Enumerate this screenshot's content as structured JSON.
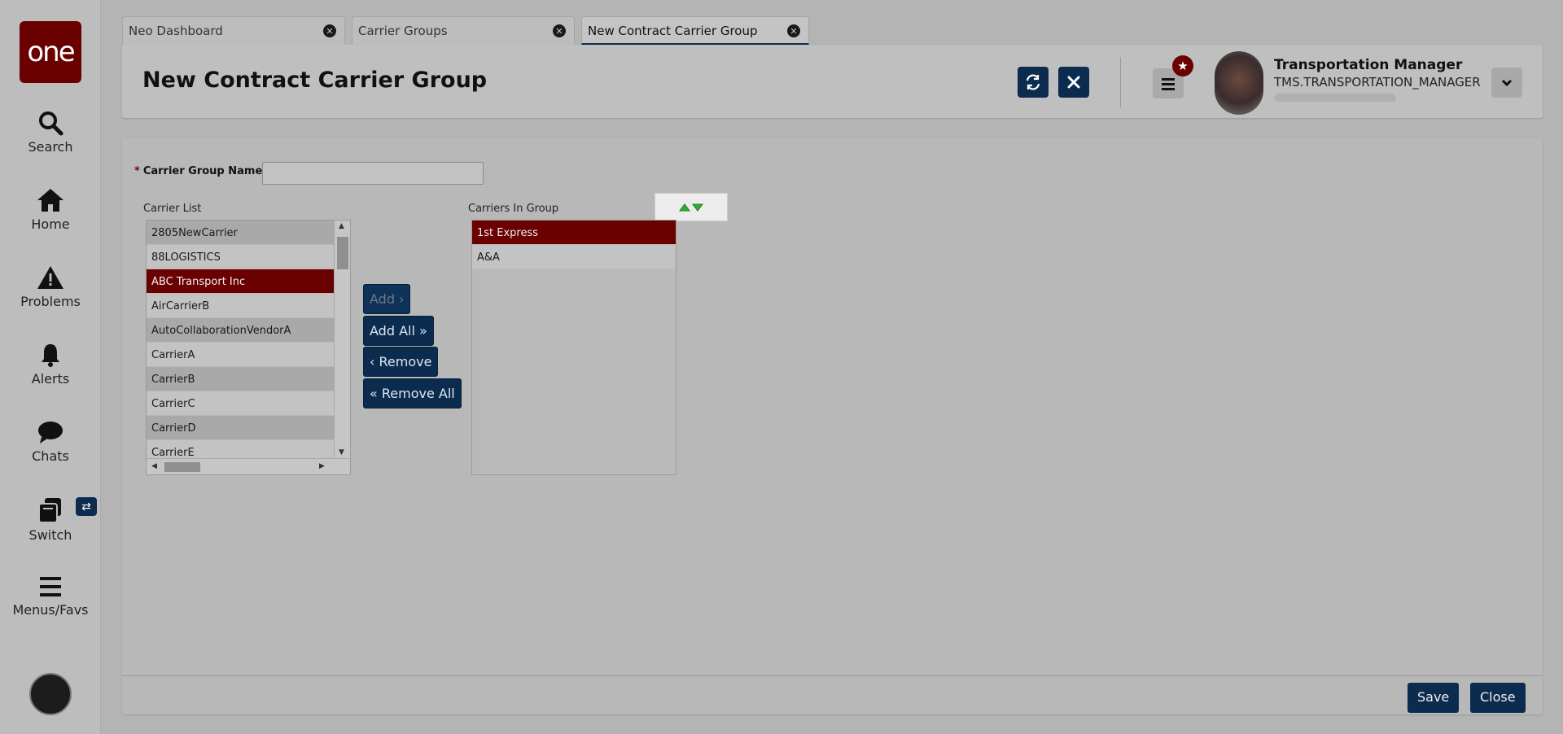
{
  "sidebar": {
    "logo": "one",
    "items": [
      {
        "label": "Search",
        "icon": "search-icon"
      },
      {
        "label": "Home",
        "icon": "home-icon"
      },
      {
        "label": "Problems",
        "icon": "warning-icon"
      },
      {
        "label": "Alerts",
        "icon": "bell-icon"
      },
      {
        "label": "Chats",
        "icon": "chat-icon"
      },
      {
        "label": "Switch",
        "icon": "switch-icon"
      },
      {
        "label": "Menus/Favs",
        "icon": "menu-icon"
      }
    ],
    "switch_badge": "⇄"
  },
  "tabs": [
    {
      "label": "Neo Dashboard",
      "active": false
    },
    {
      "label": "Carrier Groups",
      "active": false
    },
    {
      "label": "New Contract Carrier Group",
      "active": true
    }
  ],
  "header": {
    "title": "New Contract Carrier Group",
    "user_name": "Transportation Manager",
    "user_role": "TMS.TRANSPORTATION_MANAGER"
  },
  "form": {
    "name_label": "Carrier Group Name:",
    "required_mark": "*",
    "name_value": "",
    "carrier_list_label": "Carrier List",
    "carriers_in_group_label": "Carriers In Group",
    "carrier_list": [
      {
        "name": "2805NewCarrier",
        "selected": false
      },
      {
        "name": "88LOGISTICS",
        "selected": false
      },
      {
        "name": "ABC Transport Inc",
        "selected": true
      },
      {
        "name": "AirCarrierB",
        "selected": false
      },
      {
        "name": "AutoCollaborationVendorA",
        "selected": false
      },
      {
        "name": "CarrierA",
        "selected": false
      },
      {
        "name": "CarrierB",
        "selected": false
      },
      {
        "name": "CarrierC",
        "selected": false
      },
      {
        "name": "CarrierD",
        "selected": false
      },
      {
        "name": "CarrierE",
        "selected": false
      }
    ],
    "carriers_in_group": [
      {
        "name": "1st Express",
        "selected": true
      },
      {
        "name": "A&A",
        "selected": false
      }
    ],
    "buttons": {
      "add": "Add ›",
      "add_all": "Add All »",
      "remove": "‹ Remove",
      "remove_all": "« Remove All"
    }
  },
  "footer": {
    "save": "Save",
    "close": "Close"
  },
  "colors": {
    "selected_row": "#6b0000",
    "primary_button": "#0b2b4f",
    "sort_arrow": "#2fb12f"
  }
}
